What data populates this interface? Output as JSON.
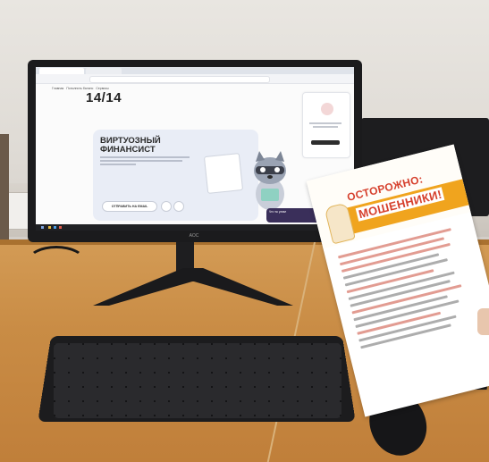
{
  "screen_app": {
    "nav": [
      "Главная",
      "Пополнить баланс",
      "Сервисы"
    ],
    "score": "14/14",
    "card": {
      "title": "ВИРТУОЗНЫЙ ФИНАНСИСТ",
      "button": "ОТПРАВИТЬ НА EMAIL"
    },
    "banner_text": "Что ты узнал"
  },
  "monitor_brand": "AOC",
  "flyer": {
    "title_line1": "ОСТОРОЖНО:",
    "title_line2": "МОШЕННИКИ!"
  },
  "colors": {
    "desk": "#c98c45",
    "flyer_accent": "#d6402d",
    "flyer_band": "#f0a41e",
    "screen_card": "#e9edf6"
  },
  "icons": [
    "raccoon-mascot-icon",
    "document-illustration-icon",
    "wallet-icon"
  ]
}
